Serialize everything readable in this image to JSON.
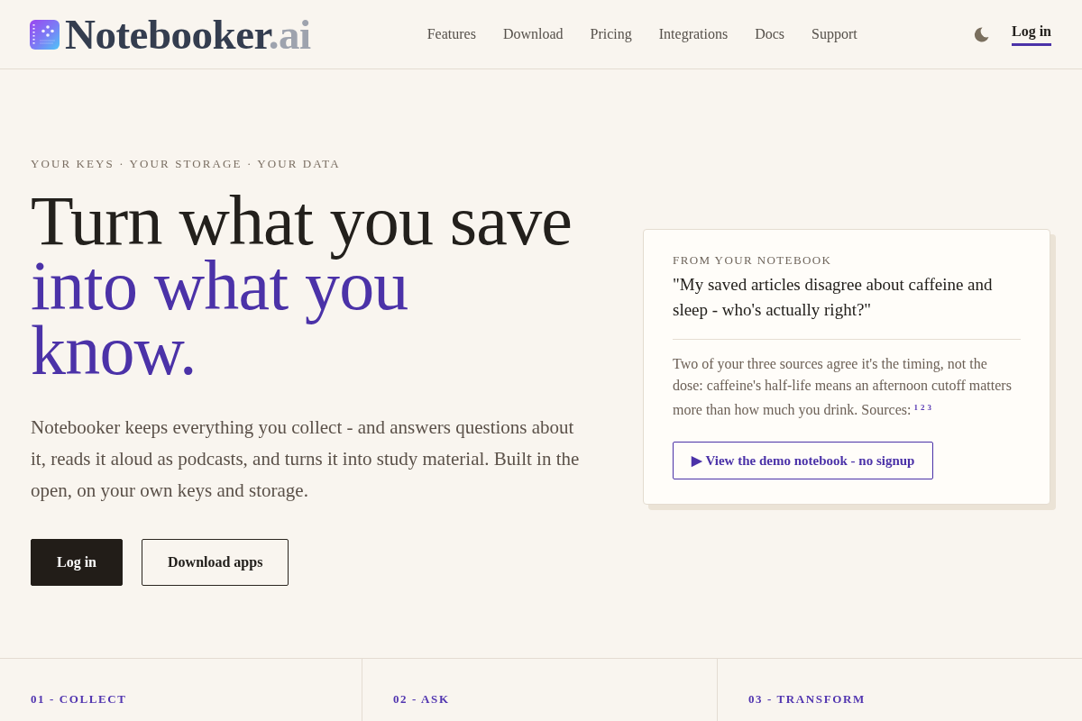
{
  "header": {
    "brand": {
      "name": "Notebooker",
      "suffix": ".ai"
    },
    "nav": [
      "Features",
      "Download",
      "Pricing",
      "Integrations",
      "Docs",
      "Support"
    ],
    "login": "Log in"
  },
  "hero": {
    "eyebrow": "YOUR KEYS · YOUR STORAGE · YOUR DATA",
    "title": "Turn what you save",
    "title_accent": "into what you know.",
    "lead": "Notebooker keeps everything you collect - and answers questions about it, reads it aloud as podcasts, and turns it into study material. Built in the open, on your own keys and storage.",
    "buttons": [
      {
        "label": "Log in",
        "kind": "primary"
      },
      {
        "label": "Download apps",
        "kind": "outline"
      }
    ]
  },
  "demo_card": {
    "eyebrow": "FROM YOUR NOTEBOOK",
    "question": "\"My saved articles disagree about caffeine and sleep - who's actually right?\"",
    "answer": "Two of your three sources agree it's the timing, not the dose: caffeine's half-life means an afternoon cutoff matters more than how much you drink. Sources:",
    "sources": [
      "1",
      "2",
      "3"
    ],
    "button": "▶ View the demo notebook - no signup"
  },
  "steps": [
    "01 - COLLECT",
    "02 - ASK",
    "03 - TRANSFORM"
  ]
}
